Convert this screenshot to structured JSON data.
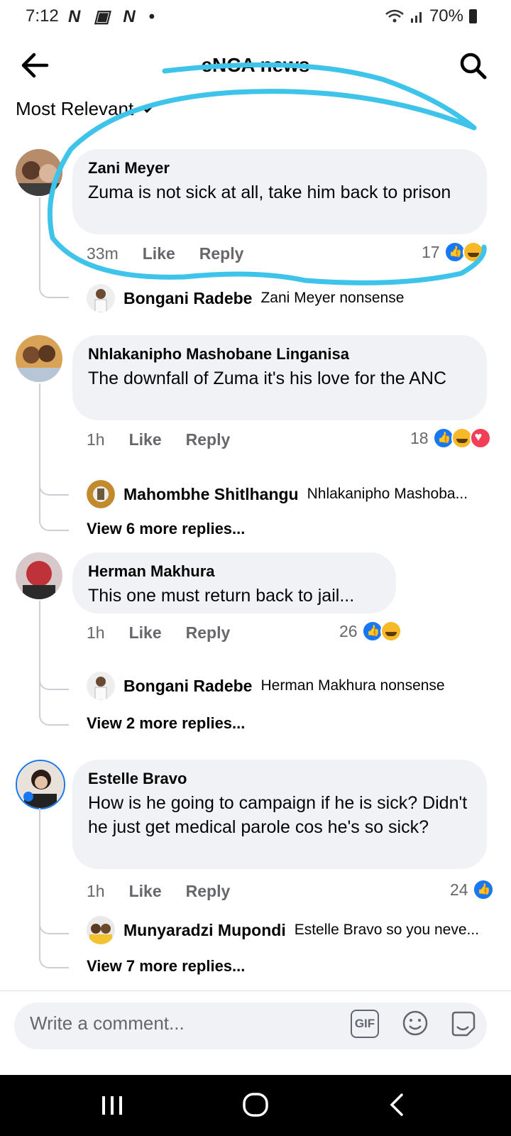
{
  "status": {
    "time": "7:12",
    "notif_icons": "N ▣ N •",
    "battery": "70%"
  },
  "header": {
    "title": "eNCA news"
  },
  "sort": {
    "label": "Most Relevant"
  },
  "comments": [
    {
      "author": "Zani Meyer",
      "text": "Zuma is not sick at all, take him back to prison",
      "time": "33m",
      "like": "Like",
      "reply": "Reply",
      "reactions": "17",
      "replies": [
        {
          "name": "Bongani Radebe",
          "text": "Zani Meyer nonsense"
        }
      ]
    },
    {
      "author": "Nhlakanipho Mashobane Linganisa",
      "text": "The downfall of Zuma it's his love for the ANC",
      "time": "1h",
      "like": "Like",
      "reply": "Reply",
      "reactions": "18",
      "replies": [
        {
          "name": "Mahombhe Shitlhangu",
          "text": "Nhlakanipho Mashoba..."
        }
      ],
      "view_more": "View 6 more replies..."
    },
    {
      "author": "Herman Makhura",
      "text": "This one must return back to jail...",
      "time": "1h",
      "like": "Like",
      "reply": "Reply",
      "reactions": "26",
      "replies": [
        {
          "name": "Bongani Radebe",
          "text": "Herman Makhura nonsense"
        }
      ],
      "view_more": "View 2 more replies..."
    },
    {
      "author": "Estelle Bravo",
      "text": "How is he going to campaign if he is sick? Didn't he just get medical parole cos he's so sick?",
      "time": "1h",
      "like": "Like",
      "reply": "Reply",
      "reactions": "24",
      "replies": [
        {
          "name": "Munyaradzi Mupondi",
          "text": "Estelle Bravo so you neve..."
        }
      ],
      "view_more": "View 7 more replies..."
    }
  ],
  "composer": {
    "placeholder": "Write a comment...",
    "gif": "GIF"
  },
  "colors": {
    "accent": "#1877f2",
    "annotation": "#3ec3ea",
    "bubble": "#f0f2f5"
  }
}
